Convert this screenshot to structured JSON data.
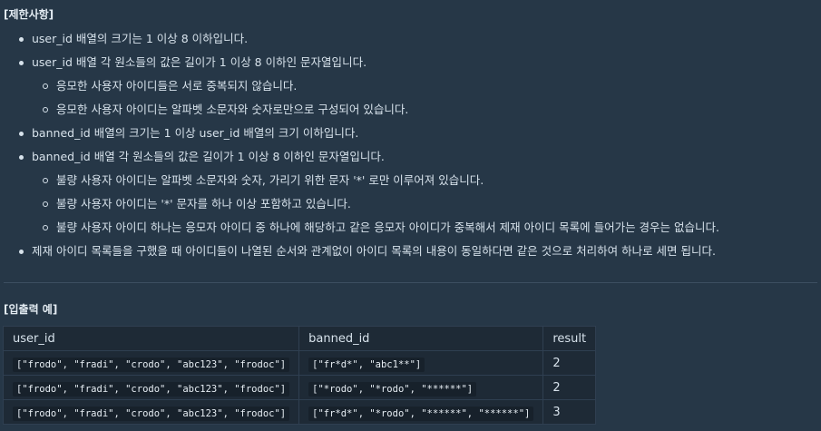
{
  "restrictions": {
    "title": "[제한사항]",
    "items": [
      {
        "level": 1,
        "text": "user_id 배열의 크기는 1 이상 8 이하입니다."
      },
      {
        "level": 1,
        "text": "user_id 배열 각 원소들의 값은 길이가 1 이상 8 이하인 문자열입니다."
      },
      {
        "level": 2,
        "text": "응모한 사용자 아이디들은 서로 중복되지 않습니다."
      },
      {
        "level": 2,
        "text": "응모한 사용자 아이디는 알파벳 소문자와 숫자로만으로 구성되어 있습니다."
      },
      {
        "level": 1,
        "text": "banned_id 배열의 크기는 1 이상 user_id 배열의 크기 이하입니다."
      },
      {
        "level": 1,
        "text": "banned_id 배열 각 원소들의 값은 길이가 1 이상 8 이하인 문자열입니다."
      },
      {
        "level": 2,
        "text": "불량 사용자 아이디는 알파벳 소문자와 숫자, 가리기 위한 문자 '*' 로만 이루어져 있습니다."
      },
      {
        "level": 2,
        "text": "불량 사용자 아이디는 '*' 문자를 하나 이상 포함하고 있습니다."
      },
      {
        "level": 2,
        "text": "불량 사용자 아이디 하나는 응모자 아이디 중 하나에 해당하고 같은 응모자 아이디가 중복해서 제재 아이디 목록에 들어가는 경우는 없습니다."
      },
      {
        "level": 1,
        "text": "제재 아이디 목록들을 구했을 때 아이디들이 나열된 순서와 관계없이 아이디 목록의 내용이 동일하다면 같은 것으로 처리하여 하나로 세면 됩니다."
      }
    ]
  },
  "examples": {
    "title": "[입출력 예]",
    "headers": [
      "user_id",
      "banned_id",
      "result"
    ],
    "rows": [
      [
        "[\"frodo\", \"fradi\", \"crodo\", \"abc123\", \"frodoc\"]",
        "[\"fr*d*\", \"abc1**\"]",
        "2"
      ],
      [
        "[\"frodo\", \"fradi\", \"crodo\", \"abc123\", \"frodoc\"]",
        "[\"*rodo\", \"*rodo\", \"******\"]",
        "2"
      ],
      [
        "[\"frodo\", \"fradi\", \"crodo\", \"abc123\", \"frodoc\"]",
        "[\"fr*d*\", \"*rodo\", \"******\", \"******\"]",
        "3"
      ]
    ]
  }
}
